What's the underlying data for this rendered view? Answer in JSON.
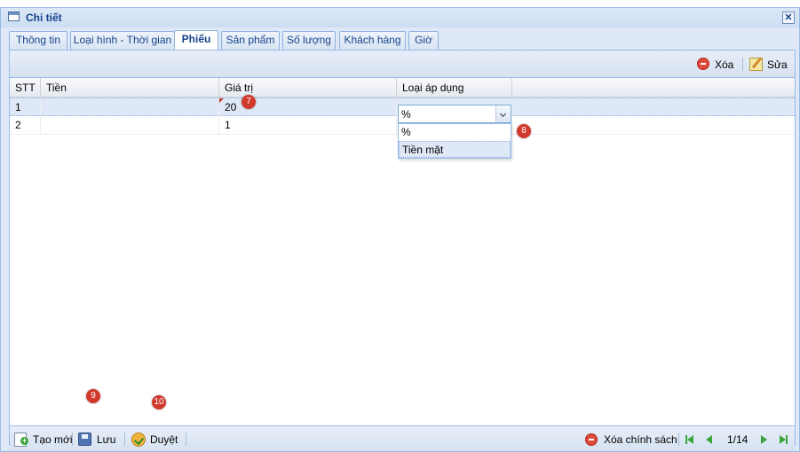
{
  "window": {
    "title": "Chi tiết",
    "close_label": "✕"
  },
  "tabs": [
    {
      "label": "Thông tin"
    },
    {
      "label": "Loại hình - Thời gian"
    },
    {
      "label": "Phiếu"
    },
    {
      "label": "Sản phẩm"
    },
    {
      "label": "Số lượng"
    },
    {
      "label": "Khách hàng"
    },
    {
      "label": "Giờ"
    }
  ],
  "active_tab": "Phiếu",
  "toolbar_top": {
    "delete_label": "Xóa",
    "edit_label": "Sửa"
  },
  "grid": {
    "columns": [
      "STT",
      "Tiền",
      "Giá trị",
      "Loại áp dụng"
    ],
    "rows": [
      {
        "stt": "1",
        "tien": "",
        "gia_tri": "20",
        "loai_ap_dung": "%"
      },
      {
        "stt": "2",
        "tien": "",
        "gia_tri": "1",
        "loai_ap_dung": ""
      }
    ]
  },
  "combo": {
    "value": "%",
    "options": [
      "%",
      "Tiền mặt"
    ]
  },
  "markers": [
    "7",
    "8",
    "9",
    "10"
  ],
  "toolbar_bottom": {
    "new_label": "Tạo mới",
    "save_label": "Lưu",
    "approve_label": "Duyệt",
    "delete_policy_label": "Xóa chính sách",
    "page_info": "1/14"
  },
  "colors": {
    "accent": "#15428b",
    "border": "#99bbe8",
    "selected_row": "#dfe8f6",
    "marker": "#d2392d"
  }
}
